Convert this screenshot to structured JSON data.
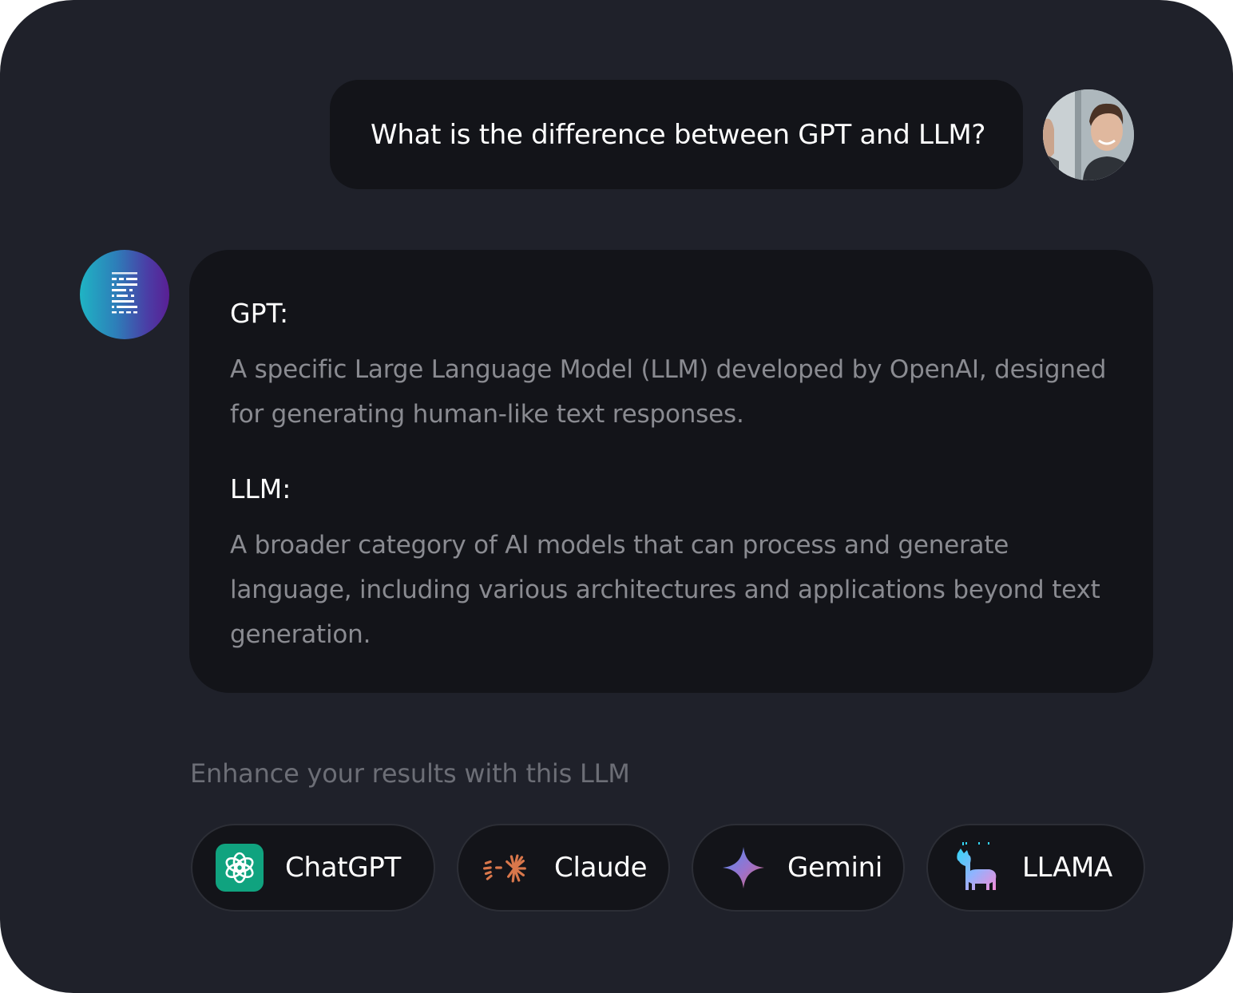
{
  "conversation": {
    "user_message": "What is the difference between GPT and LLM?",
    "assistant": {
      "sections": [
        {
          "title": "GPT:",
          "body": "A specific Large Language Model (LLM) developed by OpenAI, designed for generating human-like text responses."
        },
        {
          "title": "LLM:",
          "body": "A broader category of AI models that can process and generate language, including various architectures and applications beyond text generation."
        }
      ]
    }
  },
  "suggestions": {
    "heading": "Enhance your results with this LLM",
    "models": [
      {
        "label": "ChatGPT",
        "icon": "chatgpt-logo-icon",
        "color": "#10a37f"
      },
      {
        "label": "Claude",
        "icon": "claude-logo-icon",
        "color": "#d9774b"
      },
      {
        "label": "Gemini",
        "icon": "gemini-logo-icon",
        "color": "#6f7fdc"
      },
      {
        "label": "LLAMA",
        "icon": "llama-logo-icon",
        "color": "#4cc6f0"
      }
    ]
  },
  "colors": {
    "background": "#1f212a",
    "bubble": "#131419",
    "muted_text": "#8a8b91",
    "bot_gradient": [
      "#1fb4c4",
      "#5a1f94"
    ]
  }
}
